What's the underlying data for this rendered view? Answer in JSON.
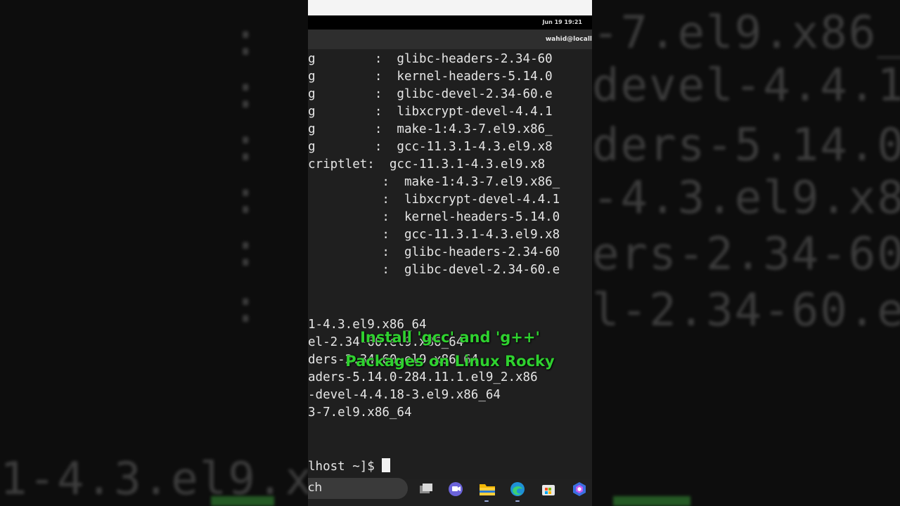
{
  "background": {
    "left_lines": [
      ":  m",
      ":  l",
      ":  k",
      ":  g",
      ":  g",
      ":  g",
      "1-4.3.el9.x"
    ],
    "right_lines": [
      "-7.el9.x86_",
      "devel-4.4.1",
      "ders-5.14.0",
      "-4.3.el9.x8",
      "ers-2.34-60",
      "l-2.34-60.e"
    ]
  },
  "status_bar": {
    "clock": "Jun 19  19:21"
  },
  "terminal": {
    "window_title_user": "wahid@locall",
    "lines_upper": [
      "g        :  glibc-headers-2.34-60",
      "g        :  kernel-headers-5.14.0",
      "g        :  glibc-devel-2.34-60.e",
      "g        :  libxcrypt-devel-4.4.1",
      "g        :  make-1:4.3-7.el9.x86_",
      "g        :  gcc-11.3.1-4.3.el9.x8",
      "criptlet:  gcc-11.3.1-4.3.el9.x8",
      "          :  make-1:4.3-7.el9.x86_",
      "          :  libxcrypt-devel-4.4.1",
      "          :  kernel-headers-5.14.0",
      "          :  gcc-11.3.1-4.3.el9.x8",
      "          :  glibc-headers-2.34-60",
      "          :  glibc-devel-2.34-60.e"
    ],
    "lines_lower": [
      "1-4.3.el9.x86_64",
      "el-2.34-60.el9.x86_64",
      "ders-2.34-60.el9.x86_64",
      "aders-5.14.0-284.11.1.el9_2.x86",
      "-devel-4.4.18-3.el9.x86_64",
      "3-7.el9.x86_64"
    ],
    "prompt": "lhost ~]$ "
  },
  "overlay": {
    "line1": "Install 'gcc' and 'g++'",
    "line2": "Packages on Linux Rocky",
    "color": "#2fd12f"
  },
  "taskbar": {
    "search_text": "ch",
    "icons": [
      "task-view-icon",
      "teams-chat-icon",
      "file-explorer-icon",
      "edge-browser-icon",
      "store-icon",
      "copilot-icon"
    ]
  }
}
